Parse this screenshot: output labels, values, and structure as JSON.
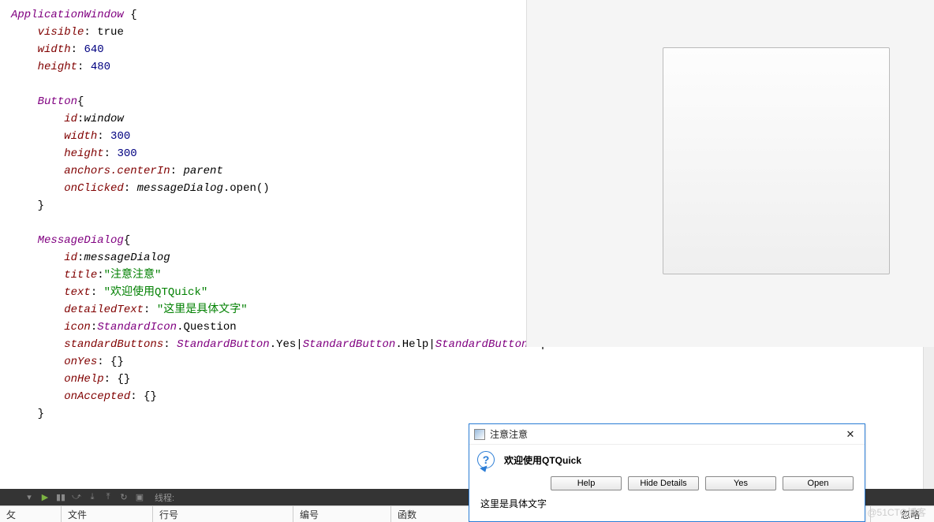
{
  "code": {
    "lines": [
      {
        "t": [
          [
            "kw",
            "ApplicationWindow"
          ],
          [
            "plain",
            " {"
          ]
        ]
      },
      {
        "t": [
          [
            "plain",
            "    "
          ],
          [
            "prop",
            "visible"
          ],
          [
            "plain",
            ": "
          ],
          [
            "val",
            "true"
          ]
        ]
      },
      {
        "t": [
          [
            "plain",
            "    "
          ],
          [
            "prop",
            "width"
          ],
          [
            "plain",
            ": "
          ],
          [
            "num",
            "640"
          ]
        ]
      },
      {
        "t": [
          [
            "plain",
            "    "
          ],
          [
            "prop",
            "height"
          ],
          [
            "plain",
            ": "
          ],
          [
            "num",
            "480"
          ]
        ]
      },
      {
        "t": []
      },
      {
        "t": [
          [
            "plain",
            "    "
          ],
          [
            "kw",
            "Button"
          ],
          [
            "plain",
            "{"
          ]
        ]
      },
      {
        "t": [
          [
            "plain",
            "        "
          ],
          [
            "prop",
            "id"
          ],
          [
            "plain",
            ":"
          ],
          [
            "id",
            "window"
          ]
        ]
      },
      {
        "t": [
          [
            "plain",
            "        "
          ],
          [
            "prop",
            "width"
          ],
          [
            "plain",
            ": "
          ],
          [
            "num",
            "300"
          ]
        ]
      },
      {
        "t": [
          [
            "plain",
            "        "
          ],
          [
            "prop",
            "height"
          ],
          [
            "plain",
            ": "
          ],
          [
            "num",
            "300"
          ]
        ]
      },
      {
        "t": [
          [
            "plain",
            "        "
          ],
          [
            "prop",
            "anchors.centerIn"
          ],
          [
            "plain",
            ": "
          ],
          [
            "id",
            "parent"
          ]
        ]
      },
      {
        "t": [
          [
            "plain",
            "        "
          ],
          [
            "prop",
            "onClicked"
          ],
          [
            "plain",
            ": "
          ],
          [
            "id",
            "messageDialog"
          ],
          [
            "plain",
            ".open()"
          ]
        ]
      },
      {
        "t": [
          [
            "plain",
            "    }"
          ]
        ]
      },
      {
        "t": []
      },
      {
        "t": [
          [
            "plain",
            "    "
          ],
          [
            "kw",
            "MessageDialog"
          ],
          [
            "plain",
            "{"
          ]
        ]
      },
      {
        "t": [
          [
            "plain",
            "        "
          ],
          [
            "prop",
            "id"
          ],
          [
            "plain",
            ":"
          ],
          [
            "id",
            "messageDialog"
          ]
        ]
      },
      {
        "t": [
          [
            "plain",
            "        "
          ],
          [
            "prop",
            "title"
          ],
          [
            "plain",
            ":"
          ],
          [
            "str",
            "\"注意注意\""
          ]
        ]
      },
      {
        "t": [
          [
            "plain",
            "        "
          ],
          [
            "prop",
            "text"
          ],
          [
            "plain",
            ": "
          ],
          [
            "str",
            "\"欢迎使用QTQuick\""
          ]
        ]
      },
      {
        "t": [
          [
            "plain",
            "        "
          ],
          [
            "prop",
            "detailedText"
          ],
          [
            "plain",
            ": "
          ],
          [
            "str",
            "\"这里是具体文字\""
          ]
        ]
      },
      {
        "t": [
          [
            "plain",
            "        "
          ],
          [
            "prop",
            "icon"
          ],
          [
            "plain",
            ":"
          ],
          [
            "kw",
            "StandardIcon"
          ],
          [
            "plain",
            ".Question"
          ]
        ]
      },
      {
        "t": [
          [
            "plain",
            "        "
          ],
          [
            "prop",
            "standardButtons"
          ],
          [
            "plain",
            ": "
          ],
          [
            "kw",
            "StandardButton"
          ],
          [
            "plain",
            ".Yes|"
          ],
          [
            "kw",
            "StandardButton"
          ],
          [
            "plain",
            ".Help|"
          ],
          [
            "kw",
            "StandardButton"
          ],
          [
            "plain",
            ".Open"
          ]
        ]
      },
      {
        "t": [
          [
            "plain",
            "        "
          ],
          [
            "prop",
            "onYes"
          ],
          [
            "plain",
            ": {}"
          ]
        ]
      },
      {
        "t": [
          [
            "plain",
            "        "
          ],
          [
            "prop",
            "onHelp"
          ],
          [
            "plain",
            ": {}"
          ]
        ]
      },
      {
        "t": [
          [
            "plain",
            "        "
          ],
          [
            "prop",
            "onAccepted"
          ],
          [
            "plain",
            ": {}"
          ]
        ]
      },
      {
        "t": [
          [
            "plain",
            "    }"
          ]
        ]
      }
    ]
  },
  "toolbar": {
    "thread_label": "线程:"
  },
  "columns": {
    "c0": "攵",
    "c1": "文件",
    "c2": "行号",
    "c3": "编号",
    "c4": "函数",
    "c5": "忽略"
  },
  "dialog": {
    "title": "注意注意",
    "text": "欢迎使用QTQuick",
    "detail": "这里是具体文字",
    "buttons": {
      "help": "Help",
      "hide_details": "Hide Details",
      "yes": "Yes",
      "open": "Open"
    }
  },
  "watermark": "@51CTO博客"
}
